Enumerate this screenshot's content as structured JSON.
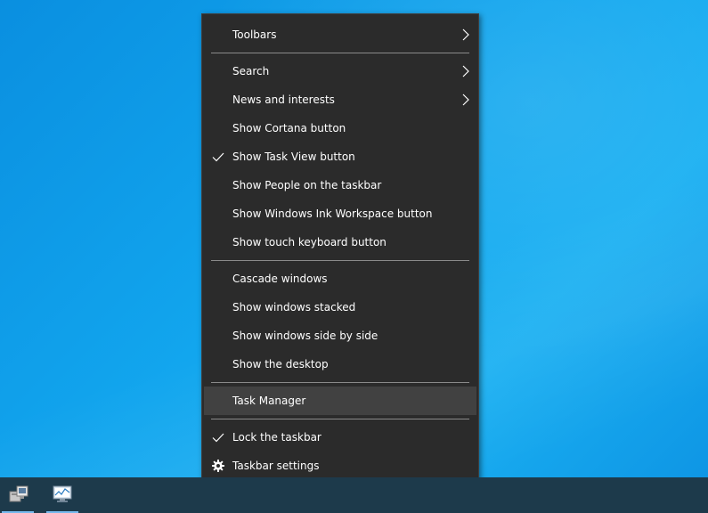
{
  "menu": {
    "items": [
      {
        "label": "Toolbars",
        "submenu": true
      },
      {
        "label": "Search",
        "submenu": true
      },
      {
        "label": "News and interests",
        "submenu": true
      },
      {
        "label": "Show Cortana button",
        "checked": false
      },
      {
        "label": "Show Task View button",
        "checked": true
      },
      {
        "label": "Show People on the taskbar",
        "checked": false
      },
      {
        "label": "Show Windows Ink Workspace button",
        "checked": false
      },
      {
        "label": "Show touch keyboard button",
        "checked": false
      },
      {
        "label": "Cascade windows"
      },
      {
        "label": "Show windows stacked"
      },
      {
        "label": "Show windows side by side"
      },
      {
        "label": "Show the desktop"
      },
      {
        "label": "Task Manager",
        "highlighted": true
      },
      {
        "label": "Lock the taskbar",
        "checked": true
      },
      {
        "label": "Taskbar settings",
        "icon": "gear-icon"
      }
    ]
  },
  "taskbar": {
    "apps": [
      {
        "icon": "computer-desktop-icon",
        "active": true
      },
      {
        "icon": "performance-monitor-icon",
        "active": true
      }
    ]
  },
  "colors": {
    "menu_background": "#2b2b2b",
    "highlight": "#414141",
    "taskbar": "#1d3a4b",
    "desktop": "#12a6ee"
  }
}
